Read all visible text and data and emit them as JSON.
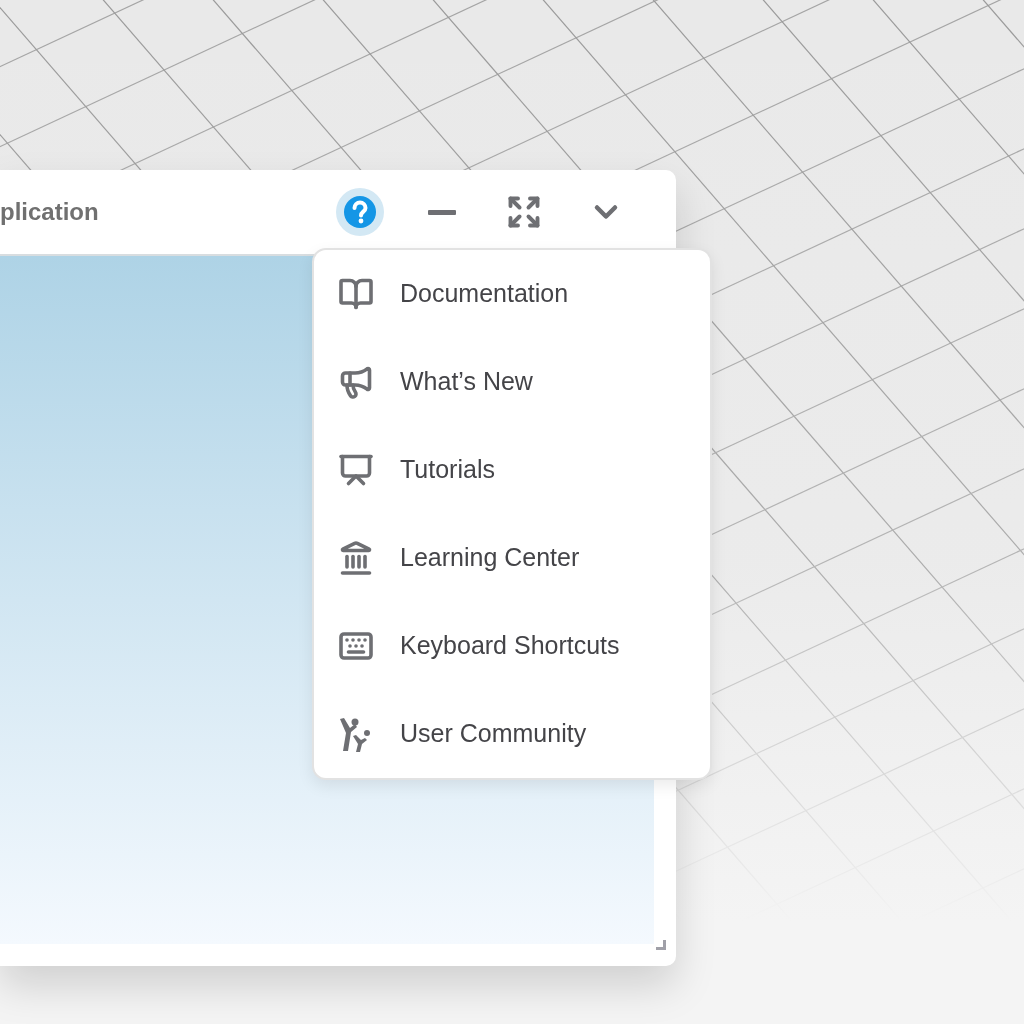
{
  "window": {
    "title": "plication",
    "controls": [
      {
        "kind": "help",
        "selected": true
      },
      {
        "kind": "minimize",
        "selected": false
      },
      {
        "kind": "expand",
        "selected": false
      },
      {
        "kind": "menu",
        "selected": false
      }
    ]
  },
  "help_menu": {
    "items": [
      {
        "label": "Documentation",
        "kind": "book"
      },
      {
        "label": "What’s New",
        "kind": "megaphone"
      },
      {
        "label": "Tutorials",
        "kind": "presentation"
      },
      {
        "label": "Learning Center",
        "kind": "building"
      },
      {
        "label": "Keyboard Shortcuts",
        "kind": "keyboard"
      },
      {
        "label": "User Community",
        "kind": "people"
      }
    ]
  }
}
